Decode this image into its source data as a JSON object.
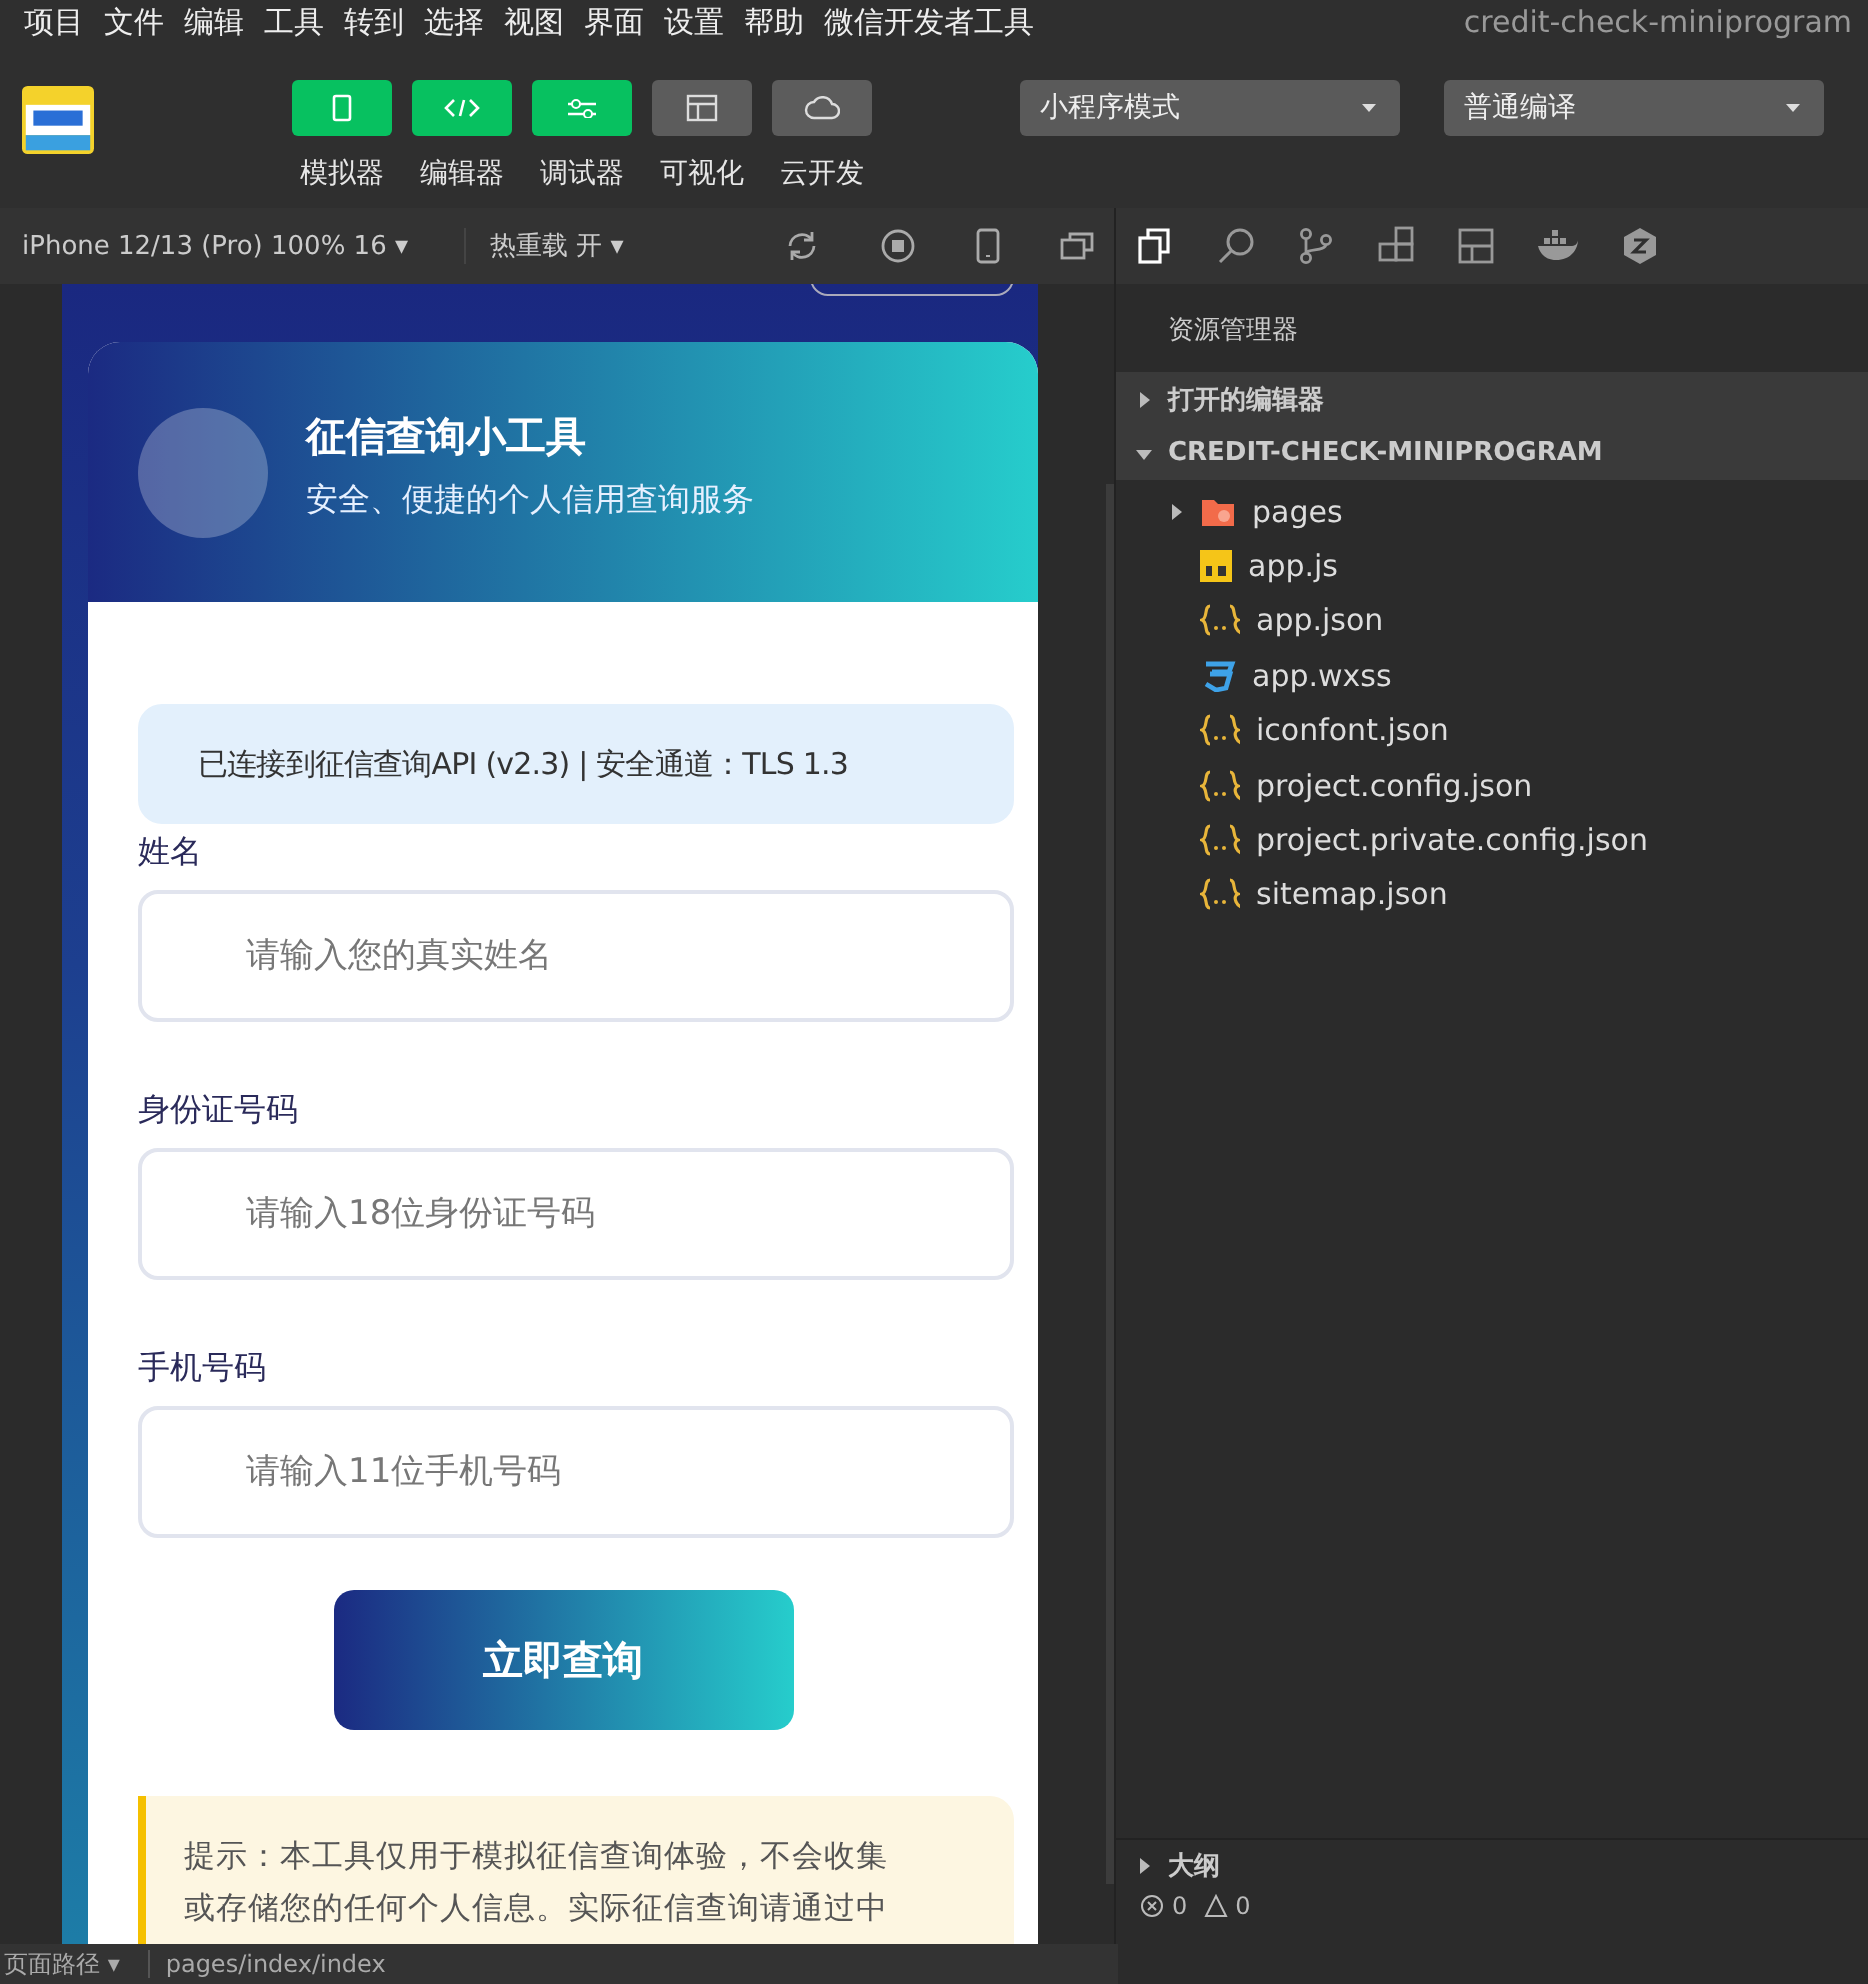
{
  "menu_bar": {
    "items": [
      "项目",
      "文件",
      "编辑",
      "工具",
      "转到",
      "选择",
      "视图",
      "界面",
      "设置",
      "帮助",
      "微信开发者工具"
    ],
    "title": "credit-check-miniprogram"
  },
  "toolbar": {
    "buttons": [
      {
        "label": "模拟器",
        "kind": "phone",
        "on": true
      },
      {
        "label": "编辑器",
        "kind": "code",
        "on": true
      },
      {
        "label": "调试器",
        "kind": "sliders",
        "on": true
      },
      {
        "label": "可视化",
        "kind": "layout",
        "on": false
      },
      {
        "label": "云开发",
        "kind": "cloud",
        "on": false
      }
    ],
    "dropdowns": [
      "小程序模式",
      "普通编译"
    ]
  },
  "simulator_bar": {
    "device": "iPhone 12/13 (Pro) 100% 16 ▾",
    "hot_reload": "热重载 开 ▾"
  },
  "app": {
    "title": "征信查询小工具",
    "subtitle": "安全、便捷的个人信用查询服务",
    "status": "已连接到征信查询API (v2.3) | 安全通道：TLS 1.3",
    "fields": [
      {
        "label": "姓名",
        "placeholder": "请输入您的真实姓名"
      },
      {
        "label": "身份证号码",
        "placeholder": "请输入18位身份证号码"
      },
      {
        "label": "手机号码",
        "placeholder": "请输入11位手机号码"
      }
    ],
    "submit": "立即查询",
    "tip": "提示：本工具仅用于模拟征信查询体验，不会收集或存储您的任何个人信息。实际征信查询请通过中"
  },
  "explorer": {
    "title": "资源管理器",
    "sections": [
      {
        "label": "打开的编辑器",
        "expanded": false
      },
      {
        "label": "CREDIT-CHECK-MINIPROGRAM",
        "expanded": true
      }
    ],
    "files": [
      {
        "name": "pages",
        "kind": "folder",
        "expanded": false
      },
      {
        "name": "app.js",
        "kind": "js"
      },
      {
        "name": "app.json",
        "kind": "json"
      },
      {
        "name": "app.wxss",
        "kind": "css"
      },
      {
        "name": "iconfont.json",
        "kind": "json"
      },
      {
        "name": "project.config.json",
        "kind": "json"
      },
      {
        "name": "project.private.config.json",
        "kind": "json"
      },
      {
        "name": "sitemap.json",
        "kind": "json"
      }
    ],
    "outline": {
      "label": "大纲",
      "expanded": false
    }
  },
  "status_bar": {
    "page_path_label": "页面路径 ▾",
    "page_path": "pages/index/index",
    "errors": "0",
    "warnings": "0"
  }
}
